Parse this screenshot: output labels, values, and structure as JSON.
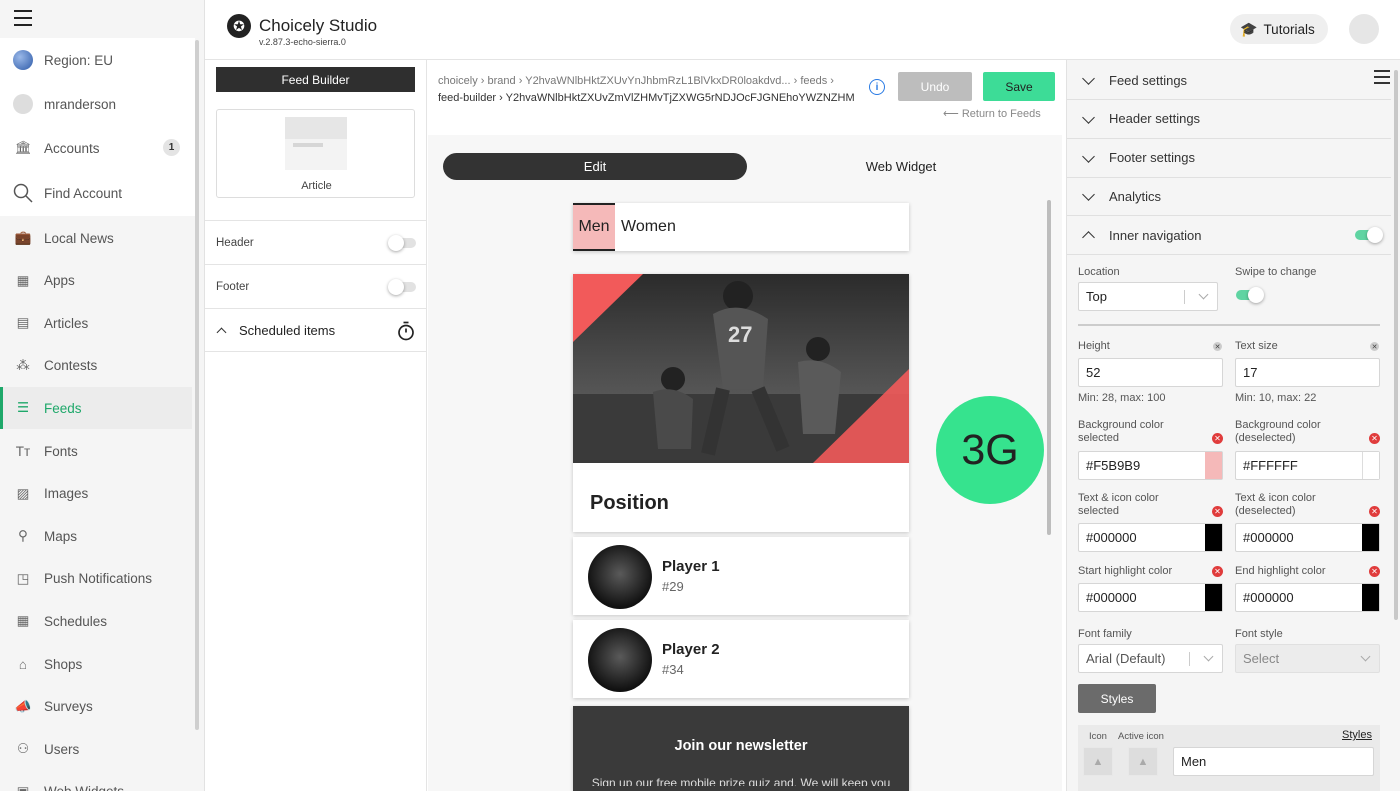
{
  "sidebar": {
    "region": "Region: EU",
    "user": "mranderson",
    "accounts": {
      "label": "Accounts",
      "count": "1"
    },
    "find_account": "Find Account",
    "items": [
      {
        "label": "Local News",
        "icon": "briefcase-icon"
      },
      {
        "label": "Apps",
        "icon": "grid-icon"
      },
      {
        "label": "Articles",
        "icon": "article-icon"
      },
      {
        "label": "Contests",
        "icon": "crowd-icon"
      },
      {
        "label": "Feeds",
        "icon": "list-icon",
        "active": true
      },
      {
        "label": "Fonts",
        "icon": "font-icon"
      },
      {
        "label": "Images",
        "icon": "image-icon"
      },
      {
        "label": "Maps",
        "icon": "map-pin-icon"
      },
      {
        "label": "Push Notifications",
        "icon": "notification-icon"
      },
      {
        "label": "Schedules",
        "icon": "calendar-icon"
      },
      {
        "label": "Shops",
        "icon": "shop-icon"
      },
      {
        "label": "Surveys",
        "icon": "megaphone-icon"
      },
      {
        "label": "Users",
        "icon": "users-icon"
      },
      {
        "label": "Web Widgets",
        "icon": "widget-icon"
      }
    ]
  },
  "header": {
    "app_title": "Choicely Studio",
    "version": "v.2.87.3-echo-sierra.0",
    "tutorials": "Tutorials"
  },
  "feed_builder": {
    "title": "Feed Builder",
    "article_label": "Article",
    "header_label": "Header",
    "header_enabled": false,
    "footer_label": "Footer",
    "footer_enabled": false,
    "scheduled_label": "Scheduled items"
  },
  "breadcrumb": {
    "line1": "choicely › brand › Y2hvaWNlbHktZXUvYnJhbmRzL1BlVkxDR0loakdvd... › feeds ›",
    "line2": "feed-builder › Y2hvaWNlbHktZXUvZmVlZHMvTjZXWG5rNDJOcFJGNEhoYWZNZHM"
  },
  "actions": {
    "undo": "Undo",
    "save": "Save",
    "return": "⟵ Return to Feeds"
  },
  "view_toggle": {
    "edit": "Edit",
    "web": "Web Widget"
  },
  "preview": {
    "tabs": [
      "Men",
      "Women"
    ],
    "hero_title": "Position",
    "players": [
      {
        "name": "Player 1",
        "number": "#29"
      },
      {
        "name": "Player 2",
        "number": "#34"
      }
    ],
    "newsletter_title": "Join our newsletter",
    "newsletter_text": "Sign up our free mobile prize quiz and. We will keep you"
  },
  "network_badge": "3G",
  "settings": {
    "sections": [
      "Feed settings",
      "Header settings",
      "Footer settings",
      "Analytics",
      "Inner navigation"
    ],
    "inner_nav_enabled": true,
    "location_label": "Location",
    "location_value": "Top",
    "swipe_label": "Swipe to change",
    "swipe_enabled": true,
    "height_label": "Height",
    "height_value": "52",
    "height_hint": "Min: 28, max: 100",
    "textsize_label": "Text size",
    "textsize_value": "17",
    "textsize_hint": "Min: 10, max: 22",
    "bg_sel_label1": "Background color",
    "bg_sel_label2": "selected",
    "bg_sel_value": "#F5B9B9",
    "bg_desel_label1": "Background color",
    "bg_desel_label2": "(deselected)",
    "bg_desel_value": "#FFFFFF",
    "txt_sel_label1": "Text & icon color",
    "txt_sel_label2": "selected",
    "txt_sel_value": "#000000",
    "txt_desel_label1": "Text & icon color",
    "txt_desel_label2": "(deselected)",
    "txt_desel_value": "#000000",
    "start_hl_label": "Start highlight color",
    "start_hl_value": "#000000",
    "end_hl_label": "End highlight color",
    "end_hl_value": "#000000",
    "font_family_label": "Font family",
    "font_family_value": "Arial (Default)",
    "font_style_label": "Font style",
    "font_style_value": "Select",
    "styles_button": "Styles",
    "icon_label": "Icon",
    "active_icon_label": "Active icon",
    "styles_link": "Styles",
    "tab_name_value": "Men"
  },
  "colors": {
    "accent": "#1ea86a",
    "save": "#3ddc97",
    "badge": "#36e38e",
    "selected_tab": "#F5B9B9"
  }
}
